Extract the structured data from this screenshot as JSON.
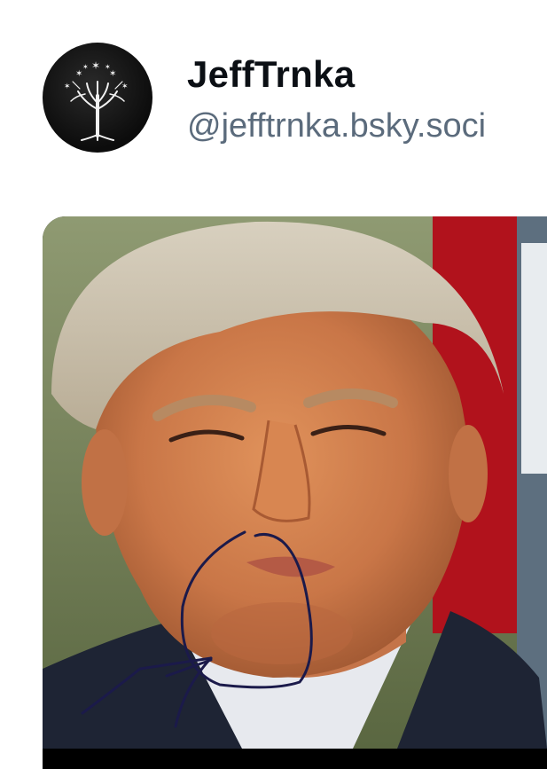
{
  "post": {
    "author": {
      "display_name": "JeffTrnka",
      "handle": "@jefftrnka.bsky.soci",
      "avatar_icon": "white-tree-icon"
    },
    "media": {
      "type": "photo",
      "subject": "face-photo-with-drawn-circle-annotation",
      "annotation_color": "#1b1a4a"
    }
  }
}
